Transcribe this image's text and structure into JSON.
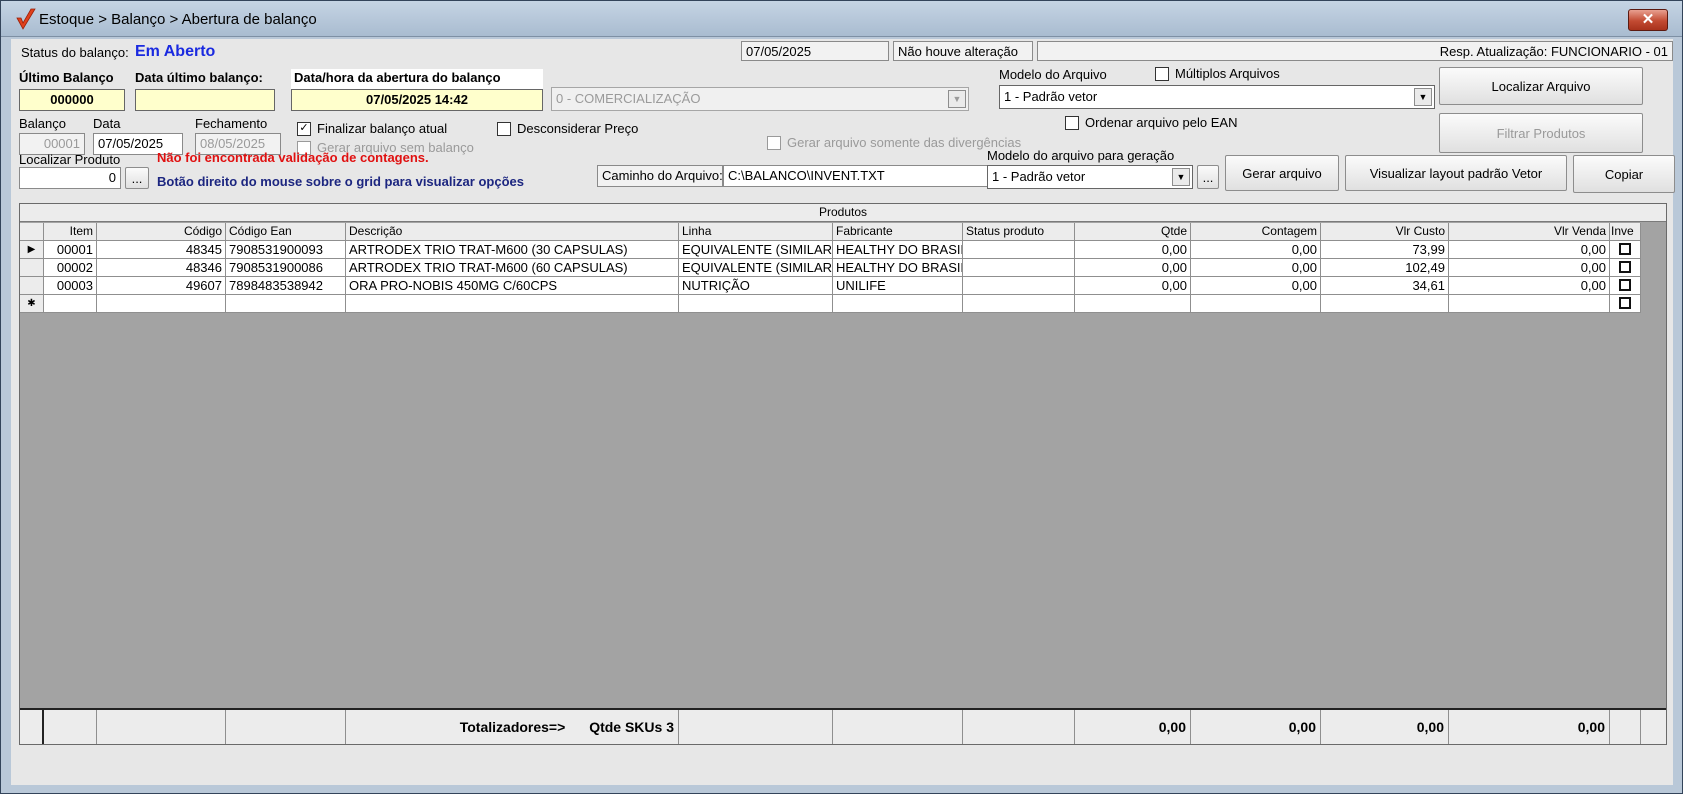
{
  "window": {
    "title": "Estoque > Balanço > Abertura de balanço",
    "close_label": "✕"
  },
  "status": {
    "label": "Status do balanço:",
    "value": "Em Aberto",
    "date": "07/05/2025",
    "alteration": "Não houve alteração",
    "resp": "Resp. Atualização: FUNCIONARIO - 01"
  },
  "ultimo_balanco": {
    "label": "Último Balanço",
    "value": "000000"
  },
  "data_ultimo": {
    "label": "Data último balanço:",
    "value": ""
  },
  "abertura": {
    "label": "Data/hora da abertura do balanço",
    "value": "07/05/2025 14:42"
  },
  "comercializacao": {
    "value": "0 - COMERCIALIZAÇÃO"
  },
  "modelo_arquivo": {
    "label": "Modelo do Arquivo",
    "value": "1 - Padrão vetor"
  },
  "multiplos": {
    "label": "Múltiplos Arquivos"
  },
  "localizar_arquivo": {
    "label": "Localizar Arquivo"
  },
  "filtrar_produtos": {
    "label": "Filtrar Produtos"
  },
  "balanco": {
    "label": "Balanço",
    "value": "00001"
  },
  "data": {
    "label": "Data",
    "value": "07/05/2025"
  },
  "fechamento": {
    "label": "Fechamento",
    "value": "08/05/2025"
  },
  "finalizar": {
    "label": "Finalizar balanço atual",
    "checked": "✓"
  },
  "gerar_sem": {
    "label": "Gerar arquivo sem balanço"
  },
  "desconsiderar": {
    "label": "Desconsiderar Preço"
  },
  "somente_div": {
    "label": "Gerar arquivo somente das divergências"
  },
  "ordenar_ean": {
    "label": "Ordenar arquivo pelo EAN"
  },
  "localizar_produto": {
    "label": "Localizar Produto",
    "value": "0",
    "btn": "..."
  },
  "messages": {
    "warning": "Não foi encontrada validação de contagens.",
    "hint": "Botão direito do mouse sobre o grid para visualizar opções"
  },
  "caminho": {
    "label": "Caminho do Arquivo:",
    "value": "C:\\BALANCO\\INVENT.TXT"
  },
  "modelo_geracao": {
    "label": "Modelo do arquivo para geração",
    "value": "1 - Padrão vetor",
    "btn": "..."
  },
  "gerar_arquivo": {
    "label": "Gerar arquivo"
  },
  "visualizar_layout": {
    "label": "Visualizar layout padrão Vetor"
  },
  "copiar": {
    "label": "Copiar"
  },
  "grid": {
    "title": "Produtos",
    "columns": [
      "Item",
      "Código",
      "Código Ean",
      "Descrição",
      "Linha",
      "Fabricante",
      "Status produto",
      "Qtde",
      "Contagem",
      "Vlr Custo",
      "Vlr Venda",
      "Inve"
    ],
    "rows": [
      {
        "indicator": "▶",
        "item": "00001",
        "codigo": "48345",
        "ean": "7908531900093",
        "descricao": "ARTRODEX TRIO TRAT-M600 (30 CAPSULAS)",
        "linha": "EQUIVALENTE (SIMILAR",
        "fabricante": "HEALTHY DO BRASIL",
        "status": "",
        "qtde": "0,00",
        "contagem": "0,00",
        "custo": "73,99",
        "venda": "0,00"
      },
      {
        "indicator": "",
        "item": "00002",
        "codigo": "48346",
        "ean": "7908531900086",
        "descricao": "ARTRODEX TRIO TRAT-M600 (60 CAPSULAS)",
        "linha": "EQUIVALENTE (SIMILAR",
        "fabricante": "HEALTHY DO BRASIL",
        "status": "",
        "qtde": "0,00",
        "contagem": "0,00",
        "custo": "102,49",
        "venda": "0,00"
      },
      {
        "indicator": "",
        "item": "00003",
        "codigo": "49607",
        "ean": "7898483538942",
        "descricao": "ORA PRO-NOBIS 450MG C/60CPS",
        "linha": "NUTRIÇÃO",
        "fabricante": "UNILIFE",
        "status": "",
        "qtde": "0,00",
        "contagem": "0,00",
        "custo": "34,61",
        "venda": "0,00"
      }
    ],
    "new_row_indicator": "✱",
    "totals": {
      "label": "Totalizadores=>",
      "skus": "Qtde SKUs 3",
      "qtde": "0,00",
      "contagem": "0,00",
      "custo": "0,00",
      "venda": "0,00"
    }
  }
}
